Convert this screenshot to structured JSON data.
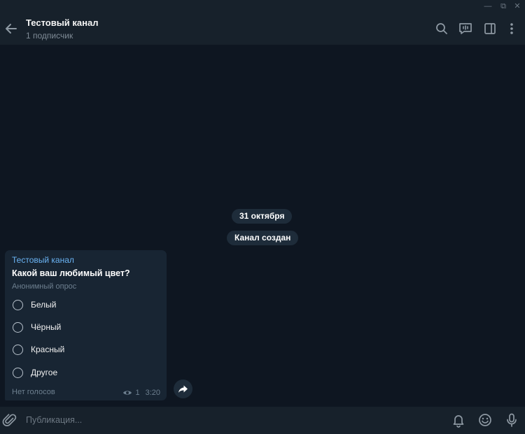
{
  "window": {
    "minimize_glyph": "—",
    "maximize_glyph": "⧉",
    "close_glyph": "✕"
  },
  "header": {
    "title": "Тестовый канал",
    "subtitle": "1 подписчик",
    "icons": [
      "back-arrow-icon",
      "search-icon",
      "live-stream-icon",
      "sidebar-toggle-icon",
      "more-vertical-icon"
    ]
  },
  "chat": {
    "date_label": "31 октября",
    "service_message": "Канал создан",
    "post": {
      "author": "Тестовый канал",
      "question": "Какой ваш любимый цвет?",
      "poll_type": "Анонимный опрос",
      "options": [
        "Белый",
        "Чёрный",
        "Красный",
        "Другое"
      ],
      "votes_label": "Нет голосов",
      "views": "1",
      "time": "3:20"
    }
  },
  "composer": {
    "placeholder": "Публикация...",
    "icons": [
      "paperclip-icon",
      "bell-icon",
      "emoji-icon",
      "microphone-icon"
    ]
  },
  "colors": {
    "background": "#0e1621",
    "panel": "#17212b",
    "bubble": "#182533",
    "accent": "#6ab3f3",
    "muted": "#6d7f8f"
  }
}
